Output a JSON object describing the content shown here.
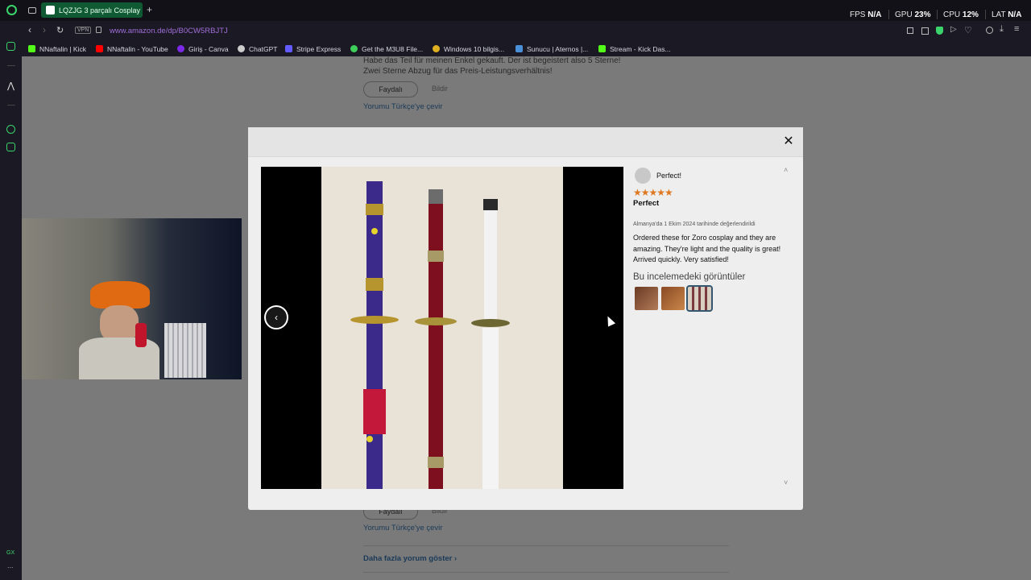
{
  "browser": {
    "tab_title": "LQZJG 3 parçalı Cosplay",
    "new_tab": "+",
    "url": "www.amazon.de/dp/B0CW5RBJTJ",
    "vpn_label": "VPN",
    "stats": {
      "fps_label": "FPS",
      "fps_value": "N/A",
      "gpu_label": "GPU",
      "gpu_value": "23%",
      "cpu_label": "CPU",
      "cpu_value": "12%",
      "lat_label": "LAT",
      "lat_value": "N/A"
    },
    "bookmarks": [
      {
        "label": "NNaftalin | Kick",
        "color": "#53fc18"
      },
      {
        "label": "NNaftalin - YouTube",
        "color": "#ff0000"
      },
      {
        "label": "Giriş - Canva",
        "color": "#7d2ae8"
      },
      {
        "label": "ChatGPT",
        "color": "#cccccc"
      },
      {
        "label": "Stripe Express",
        "color": "#635bff"
      },
      {
        "label": "Get the M3U8 File...",
        "color": "#3ecf5a"
      },
      {
        "label": "Windows 10 bilgis...",
        "color": "#e0b020"
      },
      {
        "label": "Sunucu | Aternos |...",
        "color": "#4a90d9"
      },
      {
        "label": "Stream - Kick Das...",
        "color": "#53fc18"
      }
    ],
    "sidebar_bottom": "GX",
    "sidebar_more": "..."
  },
  "page_bg": {
    "review_text_1": "Habe das Teil für meinen Enkel gekauft. Der ist begeistert also 5 Sterne!",
    "review_text_2": "Zwei Sterne Abzug für das Preis-Leistungsverhältnis!",
    "helpful_button": "Faydalı",
    "report_link": "Bildir",
    "translate_link": "Yorumu Türkçe'ye çevir",
    "helpful_button_2": "Faydalı",
    "report_link_2": "Bildir",
    "translate_link_2": "Yorumu Türkçe'ye çevir",
    "more_reviews": "Daha fazla yorum göster ›"
  },
  "modal": {
    "close_label": "✕",
    "prev_label": "‹",
    "reviewer_name": "Perfect!",
    "rating": 5,
    "stars_text": "★★★★★",
    "review_title": "Perfect",
    "review_date": "Almanya'da 1 Ekim 2024 tarihinde değerlendirildi",
    "review_body": "Ordered these for Zoro cosplay and they are amazing. They're light and the quality is great! Arrived quickly. Very satisfied!",
    "images_heading": "Bu incelemedeki görüntüler",
    "scroll_up": "˄",
    "scroll_down": "˅"
  },
  "colors": {
    "accent_green": "#0f5a32",
    "star_color": "#de7921",
    "modal_bg": "#eeeeee"
  }
}
